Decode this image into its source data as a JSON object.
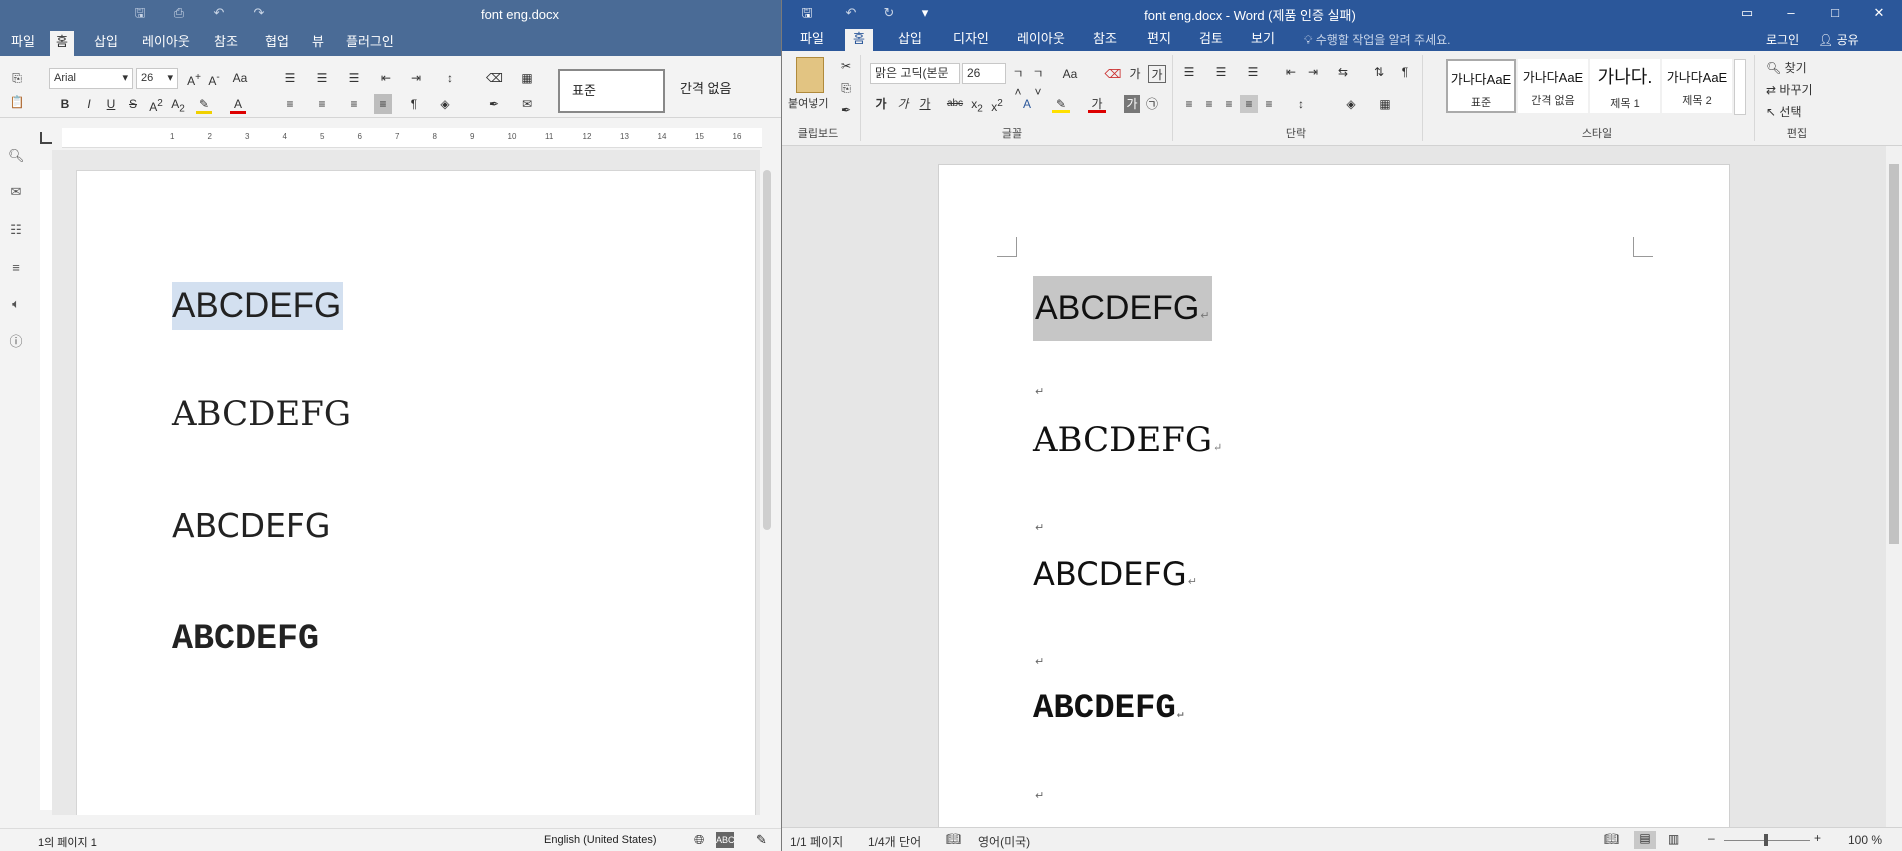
{
  "left": {
    "title": "font eng.docx",
    "menu": [
      "파일",
      "홈",
      "삽입",
      "레이아웃",
      "참조",
      "협업",
      "뷰",
      "플러그인"
    ],
    "active_menu": "홈",
    "font_name": "Arial",
    "font_size": "26",
    "style_normal": "표준",
    "style_nospace": "간격 없음",
    "doc_lines": [
      "ABCDEFG",
      "ABCDEFG",
      "ABCDEFG",
      "ABCDEFG"
    ],
    "status_page": "1의 페이지 1",
    "status_lang": "English (United States)",
    "ruler_numbers": [
      "1",
      "2",
      "3",
      "4",
      "5",
      "6",
      "7",
      "8",
      "9",
      "10",
      "11",
      "12",
      "13",
      "14",
      "15",
      "16"
    ]
  },
  "right": {
    "title": "font eng.docx - Word (제품 인증 실패)",
    "menu": [
      "파일",
      "홈",
      "삽입",
      "디자인",
      "레이아웃",
      "참조",
      "편지",
      "검토",
      "보기"
    ],
    "active_menu": "홈",
    "tell_me": "수행할 작업을 알려 주세요.",
    "login": "로그인",
    "share": "공유",
    "paste": "붙여넣기",
    "font_name": "맑은 고딕(본문",
    "font_size": "26",
    "group_clipboard": "클립보드",
    "group_font": "글꼴",
    "group_paragraph": "단락",
    "group_styles": "스타일",
    "group_edit": "편집",
    "styles": [
      {
        "preview": "가나다AaE",
        "name": "표준"
      },
      {
        "preview": "가나다AaE",
        "name": "간격 없음"
      },
      {
        "preview": "가나다.",
        "name": "제목 1"
      },
      {
        "preview": "가나다AaE",
        "name": "제목 2"
      }
    ],
    "find": "찾기",
    "replace": "바꾸기",
    "select": "선택",
    "doc_lines": [
      "ABCDEFG",
      "ABCDEFG",
      "ABCDEFG",
      "ABCDEFG"
    ],
    "status_page": "1/1 페이지",
    "status_words": "1/4개 단어",
    "status_lang": "영어(미국)",
    "zoom": "100 %"
  },
  "colors": {
    "left_title": "#4a6b96",
    "right_title": "#2b579a",
    "selection_left": "#d3e0f0",
    "selection_right": "#c6c6c6"
  }
}
